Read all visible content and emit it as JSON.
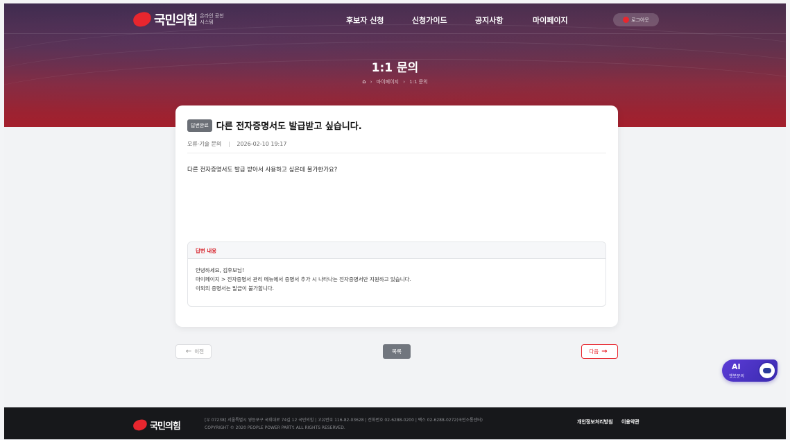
{
  "nav": {
    "logo_text": "국민의힘",
    "logo_sub": "온라인 공천시스템",
    "menu": [
      "후보자 신청",
      "신청가이드",
      "공지사항",
      "마이페이지"
    ],
    "logout": "로그아웃"
  },
  "hero": {
    "title": "1:1 문의",
    "breadcrumb": [
      "마이페이지",
      "1:1 문의"
    ]
  },
  "inquiry": {
    "status_badge": "답변완료",
    "title": "다른 전자증명서도 발급받고 싶습니다.",
    "category": "오류·기술 문의",
    "datetime": "2026-02-10 19:17",
    "body": "다른 전자증명서도 발급 받아서 사용하고 싶은데 불가한가요?"
  },
  "answer": {
    "heading": "답변 내용",
    "lines": [
      "안녕하세요, 김후보님!",
      "마이페이지 > 전자증명서 관리 메뉴에서 증명서 추가 시 나타나는 전자증명서만 지원하고 있습니다.",
      "이외의 증명서는 발급이 불가합니다."
    ]
  },
  "buttons": {
    "prev": "이전",
    "list": "목록",
    "next": "다음"
  },
  "ai_chat": {
    "label": "AI",
    "sub": "챗봇문의"
  },
  "footer": {
    "logo_text": "국민의힘",
    "address": "[우 07238] 서울특별시 영등포구 국회대로 74길 12 국민의힘  |  고유번호 116-82-03628  |  전화번호 02-6288-0200  |  팩스 02-6288-0272(국민소통센터)",
    "copyright": "COPYRIGHT © 2020 PEOPLE POWER PARTY. ALL RIGHTS RESERVED.",
    "links": [
      "개인정보처리방침",
      "이용약관"
    ]
  },
  "colors": {
    "brand_red": "#e8262e",
    "footer_bg": "#17181b",
    "badge_gray": "#6b6f76"
  }
}
